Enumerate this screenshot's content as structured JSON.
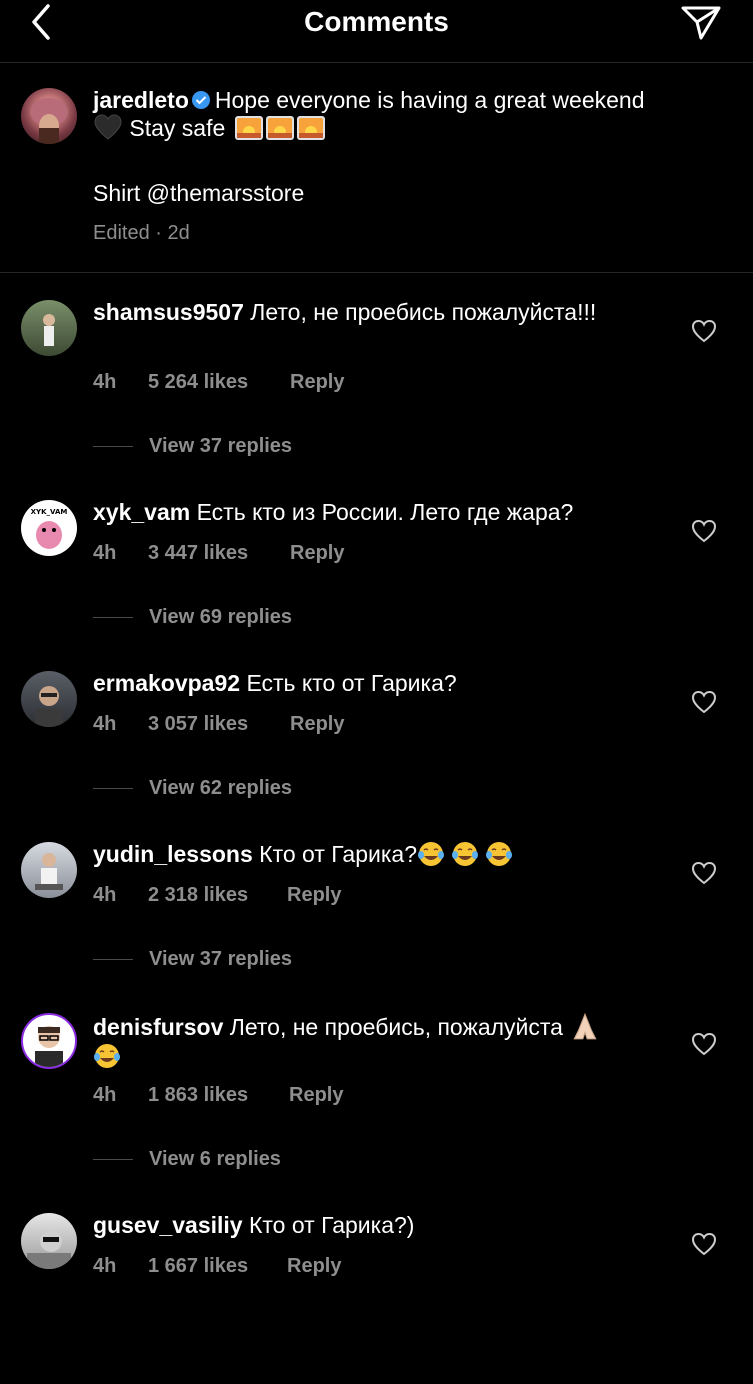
{
  "header": {
    "title": "Comments"
  },
  "post": {
    "username": "jaredleto",
    "caption_line1": "Hope everyone is having a great weekend",
    "caption_line2": "Stay safe",
    "shirt": "Shirt @themarsstore",
    "meta": "Edited · 2d"
  },
  "comments": [
    {
      "username": "shamsus9507",
      "text": "Лето, не проебись пожалуйста!!!",
      "time": "4h",
      "likes": "5 264 likes",
      "reply": "Reply",
      "replies": "View 37 replies"
    },
    {
      "username": "xyk_vam",
      "text": "Есть кто из России. Лето где жара?",
      "time": "4h",
      "likes": "3 447 likes",
      "reply": "Reply",
      "replies": "View 69 replies"
    },
    {
      "username": "ermakovpa92",
      "text": "Есть кто от Гарика?",
      "time": "4h",
      "likes": "3 057 likes",
      "reply": "Reply",
      "replies": "View 62 replies"
    },
    {
      "username": "yudin_lessons",
      "text": "Кто от Гарика?",
      "time": "4h",
      "likes": "2 318 likes",
      "reply": "Reply",
      "replies": "View 37 replies"
    },
    {
      "username": "denisfursov",
      "text": "Лето, не проебись, пожалуйста",
      "time": "4h",
      "likes": "1 863 likes",
      "reply": "Reply",
      "replies": "View 6 replies"
    },
    {
      "username": "gusev_vasiliy",
      "text": "Кто от Гарика?)",
      "time": "4h",
      "likes": "1 667 likes",
      "reply": "Reply",
      "replies": ""
    }
  ],
  "icons": {
    "back": "chevron-left-icon",
    "send": "paper-plane-icon",
    "heart": "heart-outline-icon",
    "verified": "verified-badge-icon",
    "accent": "#3897f0"
  }
}
